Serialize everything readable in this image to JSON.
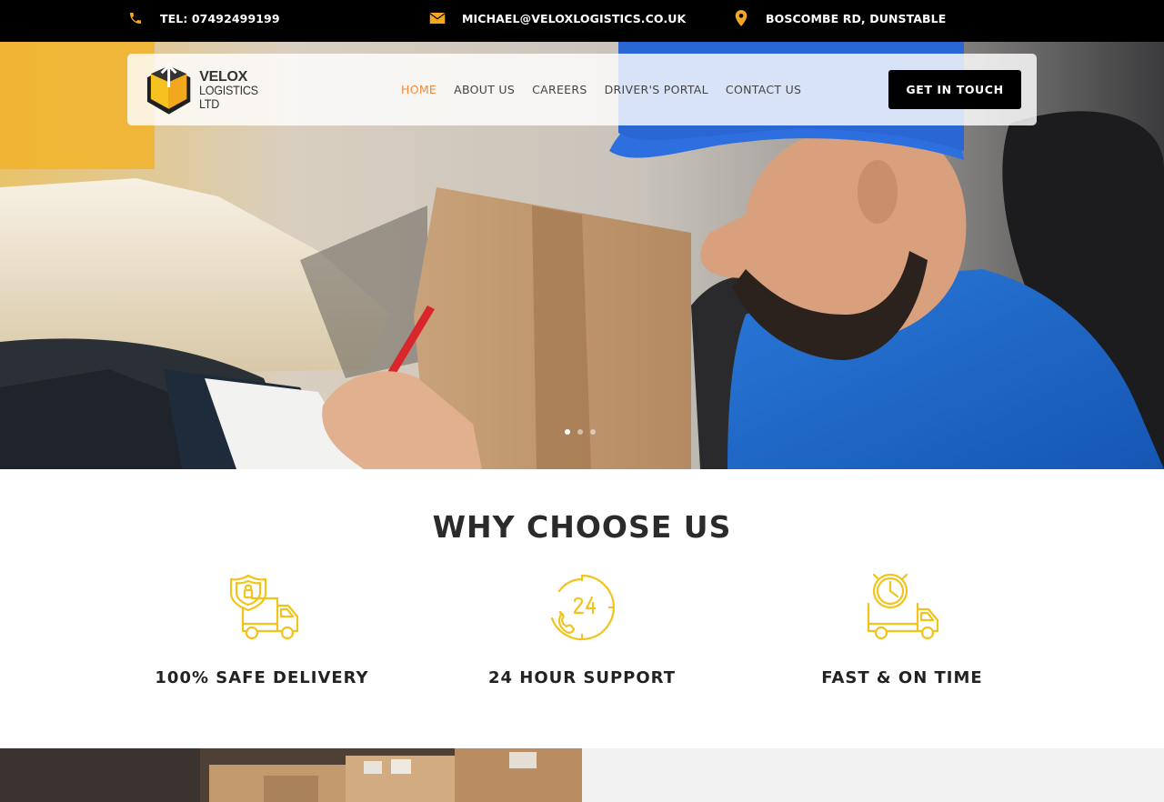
{
  "topbar": {
    "phone": "TEL: 07492499199",
    "email": "MICHAEL@VELOXLOGISTICS.CO.UK",
    "address": "BOSCOMBE RD, DUNSTABLE",
    "icon_color": "#f5a623"
  },
  "header": {
    "logo_line1": "VELOX",
    "logo_line2": "LOGISTICS LTD",
    "nav": [
      {
        "label": "HOME",
        "active": true
      },
      {
        "label": "ABOUT US"
      },
      {
        "label": "CAREERS"
      },
      {
        "label": "DRIVER'S PORTAL"
      },
      {
        "label": "CONTACT US"
      }
    ],
    "cta_label": "GET IN TOUCH",
    "active_color": "#ef8a3c"
  },
  "hero": {
    "slides_total": 3,
    "current_slide": 1
  },
  "why": {
    "title": "WHY CHOOSE US",
    "icon_color": "#f2c31a",
    "features": [
      {
        "icon": "shield-truck-icon",
        "title": "100% SAFE DELIVERY"
      },
      {
        "icon": "24-hour-phone-icon",
        "title": "24 HOUR SUPPORT"
      },
      {
        "icon": "clock-truck-icon",
        "title": "FAST & ON TIME"
      }
    ]
  }
}
